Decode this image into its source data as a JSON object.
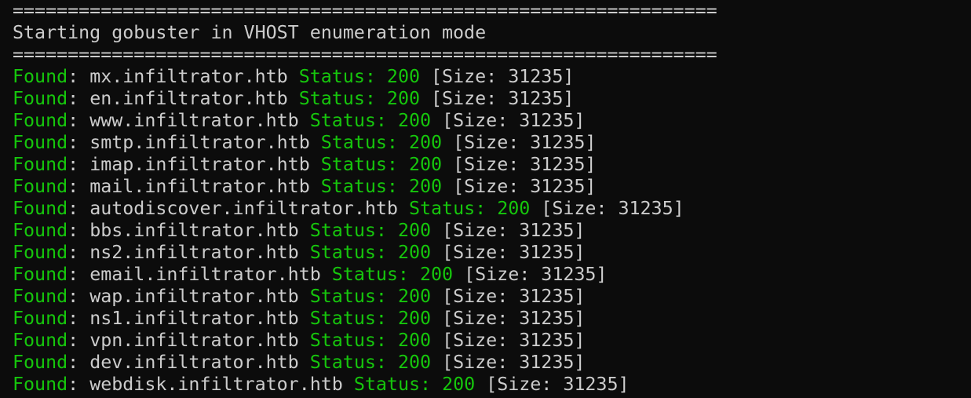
{
  "terminal": {
    "separator": "================================================================",
    "header_line": "Starting gobuster in VHOST enumeration mode",
    "found_label": "Found",
    "status_label": "Status:",
    "results": [
      {
        "host": "mx.infiltrator.htb",
        "status": "200",
        "size": "[Size: 31235]"
      },
      {
        "host": "en.infiltrator.htb",
        "status": "200",
        "size": "[Size: 31235]"
      },
      {
        "host": "www.infiltrator.htb",
        "status": "200",
        "size": "[Size: 31235]"
      },
      {
        "host": "smtp.infiltrator.htb",
        "status": "200",
        "size": "[Size: 31235]"
      },
      {
        "host": "imap.infiltrator.htb",
        "status": "200",
        "size": "[Size: 31235]"
      },
      {
        "host": "mail.infiltrator.htb",
        "status": "200",
        "size": "[Size: 31235]"
      },
      {
        "host": "autodiscover.infiltrator.htb",
        "status": "200",
        "size": "[Size: 31235]"
      },
      {
        "host": "bbs.infiltrator.htb",
        "status": "200",
        "size": "[Size: 31235]"
      },
      {
        "host": "ns2.infiltrator.htb",
        "status": "200",
        "size": "[Size: 31235]"
      },
      {
        "host": "email.infiltrator.htb",
        "status": "200",
        "size": "[Size: 31235]"
      },
      {
        "host": "wap.infiltrator.htb",
        "status": "200",
        "size": "[Size: 31235]"
      },
      {
        "host": "ns1.infiltrator.htb",
        "status": "200",
        "size": "[Size: 31235]"
      },
      {
        "host": "vpn.infiltrator.htb",
        "status": "200",
        "size": "[Size: 31235]"
      },
      {
        "host": "dev.infiltrator.htb",
        "status": "200",
        "size": "[Size: 31235]"
      },
      {
        "host": "webdisk.infiltrator.htb",
        "status": "200",
        "size": "[Size: 31235]"
      }
    ],
    "colors": {
      "background": "#0c0c0c",
      "text": "#cccccc",
      "green": "#16c60c"
    }
  }
}
